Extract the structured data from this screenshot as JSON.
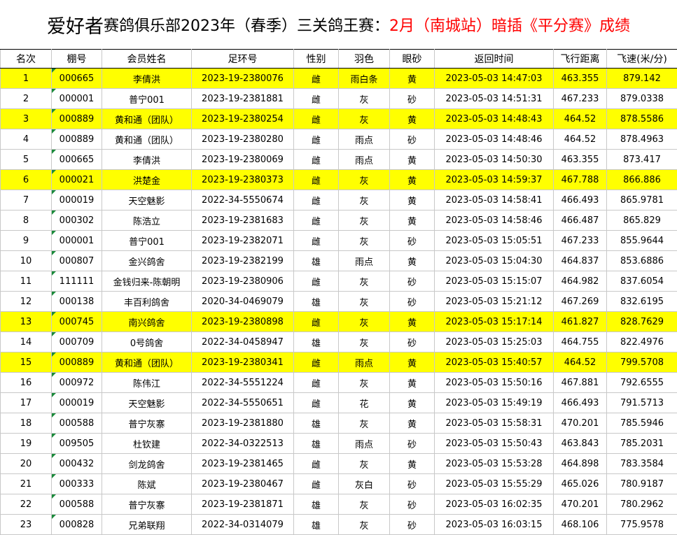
{
  "title": {
    "brand": "爱好者",
    "main": "赛鸽俱乐部2023年（春季）三关鸽王赛：",
    "highlight": "2月（南城站）暗插《平分赛》成绩"
  },
  "headers": [
    "名次",
    "棚号",
    "会员姓名",
    "足环号",
    "性别",
    "羽色",
    "眼砂",
    "返回时间",
    "飞行距离",
    "飞速(米/分)"
  ],
  "colors": {
    "highlight_row": "#ffff00",
    "title_red": "#ff0000",
    "cell_marker": "#1a8a3a"
  },
  "rows": [
    {
      "rank": "1",
      "shed": "000665",
      "name": "李倩洪",
      "ring": "2023-19-2380076",
      "sex": "雌",
      "color": "雨白条",
      "eye": "黄",
      "time": "2023-05-03 14:47:03",
      "dist": "463.355",
      "speed": "879.142",
      "hl": true
    },
    {
      "rank": "2",
      "shed": "000001",
      "name": "普宁001",
      "ring": "2023-19-2381881",
      "sex": "雌",
      "color": "灰",
      "eye": "砂",
      "time": "2023-05-03 14:51:31",
      "dist": "467.233",
      "speed": "879.0338",
      "hl": false
    },
    {
      "rank": "3",
      "shed": "000889",
      "name": "黄和通（团队）",
      "ring": "2023-19-2380254",
      "sex": "雌",
      "color": "灰",
      "eye": "黄",
      "time": "2023-05-03 14:48:43",
      "dist": "464.52",
      "speed": "878.5586",
      "hl": true
    },
    {
      "rank": "4",
      "shed": "000889",
      "name": "黄和通（团队）",
      "ring": "2023-19-2380280",
      "sex": "雌",
      "color": "雨点",
      "eye": "砂",
      "time": "2023-05-03 14:48:46",
      "dist": "464.52",
      "speed": "878.4963",
      "hl": false
    },
    {
      "rank": "5",
      "shed": "000665",
      "name": "李倩洪",
      "ring": "2023-19-2380069",
      "sex": "雌",
      "color": "雨点",
      "eye": "黄",
      "time": "2023-05-03 14:50:30",
      "dist": "463.355",
      "speed": "873.417",
      "hl": false
    },
    {
      "rank": "6",
      "shed": "000021",
      "name": "洪楚金",
      "ring": "2023-19-2380373",
      "sex": "雌",
      "color": "灰",
      "eye": "黄",
      "time": "2023-05-03 14:59:37",
      "dist": "467.788",
      "speed": "866.886",
      "hl": true
    },
    {
      "rank": "7",
      "shed": "000019",
      "name": "天空魅影",
      "ring": "2022-34-5550674",
      "sex": "雌",
      "color": "灰",
      "eye": "黄",
      "time": "2023-05-03 14:58:41",
      "dist": "466.493",
      "speed": "865.9781",
      "hl": false
    },
    {
      "rank": "8",
      "shed": "000302",
      "name": "陈浩立",
      "ring": "2023-19-2381683",
      "sex": "雌",
      "color": "灰",
      "eye": "黄",
      "time": "2023-05-03 14:58:46",
      "dist": "466.487",
      "speed": "865.829",
      "hl": false
    },
    {
      "rank": "9",
      "shed": "000001",
      "name": "普宁001",
      "ring": "2023-19-2382071",
      "sex": "雌",
      "color": "灰",
      "eye": "砂",
      "time": "2023-05-03 15:05:51",
      "dist": "467.233",
      "speed": "855.9644",
      "hl": false
    },
    {
      "rank": "10",
      "shed": "000807",
      "name": "金兴鸽舍",
      "ring": "2023-19-2382199",
      "sex": "雄",
      "color": "雨点",
      "eye": "黄",
      "time": "2023-05-03 15:04:30",
      "dist": "464.837",
      "speed": "853.6886",
      "hl": false
    },
    {
      "rank": "11",
      "shed": "111111",
      "name": "金钱归来-陈朝明",
      "ring": "2023-19-2380906",
      "sex": "雌",
      "color": "灰",
      "eye": "砂",
      "time": "2023-05-03 15:15:07",
      "dist": "464.982",
      "speed": "837.6054",
      "hl": false
    },
    {
      "rank": "12",
      "shed": "000138",
      "name": "丰百利鸽舍",
      "ring": "2020-34-0469079",
      "sex": "雄",
      "color": "灰",
      "eye": "砂",
      "time": "2023-05-03 15:21:12",
      "dist": "467.269",
      "speed": "832.6195",
      "hl": false
    },
    {
      "rank": "13",
      "shed": "000745",
      "name": "南兴鸽舍",
      "ring": "2023-19-2380898",
      "sex": "雌",
      "color": "灰",
      "eye": "黄",
      "time": "2023-05-03 15:17:14",
      "dist": "461.827",
      "speed": "828.7629",
      "hl": true
    },
    {
      "rank": "14",
      "shed": "000709",
      "name": "0号鸽舍",
      "ring": "2022-34-0458947",
      "sex": "雄",
      "color": "灰",
      "eye": "砂",
      "time": "2023-05-03 15:25:03",
      "dist": "464.755",
      "speed": "822.4976",
      "hl": false
    },
    {
      "rank": "15",
      "shed": "000889",
      "name": "黄和通（团队）",
      "ring": "2023-19-2380341",
      "sex": "雌",
      "color": "雨点",
      "eye": "黄",
      "time": "2023-05-03 15:40:57",
      "dist": "464.52",
      "speed": "799.5708",
      "hl": true
    },
    {
      "rank": "16",
      "shed": "000972",
      "name": "陈伟江",
      "ring": "2022-34-5551224",
      "sex": "雌",
      "color": "灰",
      "eye": "黄",
      "time": "2023-05-03 15:50:16",
      "dist": "467.881",
      "speed": "792.6555",
      "hl": false
    },
    {
      "rank": "17",
      "shed": "000019",
      "name": "天空魅影",
      "ring": "2022-34-5550651",
      "sex": "雌",
      "color": "花",
      "eye": "黄",
      "time": "2023-05-03 15:49:19",
      "dist": "466.493",
      "speed": "791.5713",
      "hl": false
    },
    {
      "rank": "18",
      "shed": "000588",
      "name": "普宁灰寨",
      "ring": "2023-19-2381880",
      "sex": "雄",
      "color": "灰",
      "eye": "黄",
      "time": "2023-05-03 15:58:31",
      "dist": "470.201",
      "speed": "785.5946",
      "hl": false
    },
    {
      "rank": "19",
      "shed": "009505",
      "name": "杜钦建",
      "ring": "2022-34-0322513",
      "sex": "雄",
      "color": "雨点",
      "eye": "砂",
      "time": "2023-05-03 15:50:43",
      "dist": "463.843",
      "speed": "785.2031",
      "hl": false
    },
    {
      "rank": "20",
      "shed": "000432",
      "name": "剑龙鸽舍",
      "ring": "2023-19-2381465",
      "sex": "雌",
      "color": "灰",
      "eye": "黄",
      "time": "2023-05-03 15:53:28",
      "dist": "464.898",
      "speed": "783.3584",
      "hl": false
    },
    {
      "rank": "21",
      "shed": "000333",
      "name": "陈斌",
      "ring": "2023-19-2380467",
      "sex": "雌",
      "color": "灰白",
      "eye": "砂",
      "time": "2023-05-03 15:55:29",
      "dist": "465.026",
      "speed": "780.9187",
      "hl": false
    },
    {
      "rank": "22",
      "shed": "000588",
      "name": "普宁灰寨",
      "ring": "2023-19-2381871",
      "sex": "雄",
      "color": "灰",
      "eye": "砂",
      "time": "2023-05-03 16:02:35",
      "dist": "470.201",
      "speed": "780.2962",
      "hl": false
    },
    {
      "rank": "23",
      "shed": "000828",
      "name": "兄弟联翔",
      "ring": "2022-34-0314079",
      "sex": "雄",
      "color": "灰",
      "eye": "砂",
      "time": "2023-05-03 16:03:15",
      "dist": "468.106",
      "speed": "775.9578",
      "hl": false
    }
  ]
}
